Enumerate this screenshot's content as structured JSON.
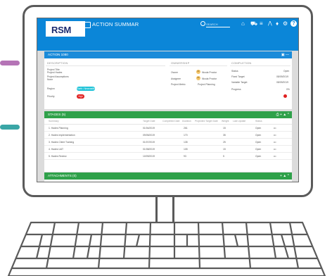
{
  "header": {
    "logo_text": "RSM",
    "app_title": "ACTION SUMMAR",
    "search_placeholder": "SEARCH",
    "icons": [
      "search-icon",
      "home-icon",
      "car-icon",
      "list-icon",
      "chart-icon",
      "bell-icon",
      "gear-icon",
      "help-icon"
    ]
  },
  "action": {
    "bar_title": "ACTION 1080",
    "description": {
      "heading": "DESCRIPTION",
      "project_title_label": "Project Title",
      "project_title_value": "Project Hades",
      "assumptions_label": "Project Assumptions",
      "assumptions_value": "None",
      "region_label": "Region",
      "region_value": "North / Newcastle",
      "priority_label": "Priority",
      "priority_value": "High"
    },
    "ownership": {
      "heading": "OWNERSHIP",
      "owner_label": "Owner",
      "owner_initials": "NP",
      "owner_value": "Nicola Proctor",
      "assignee_label": "Assignee",
      "assignee_initials": "NP",
      "assignee_value": "Nicola Proctor",
      "project_metric_label": "Project Metric",
      "project_metric_value": "Project Planning"
    },
    "completion": {
      "heading": "COMPLETION",
      "status_label": "Status",
      "status_value": "Open",
      "fixed_target_label": "Fixed Target",
      "fixed_target_value": "08/09/2019",
      "variable_target_label": "Variable Target",
      "variable_target_value": "08/09/2019",
      "progress_label": "Progress",
      "progress_value": "0%",
      "progress_fraction": 0.0,
      "status_dot_color": "#e02020"
    }
  },
  "stages": {
    "bar_title": "STAGES (5)",
    "columns": [
      "Summary",
      "Target Date",
      "Completed Date",
      "Duration",
      "Projected Target Date",
      "Weight",
      "Last Update",
      "Status"
    ],
    "rows": [
      {
        "summary": "1. Hades Planning",
        "target": "01/04/2019",
        "completed": "",
        "duration": "261",
        "projected": "",
        "weight": "15",
        "last_update": "",
        "status": "Open"
      },
      {
        "summary": "2. Hades Implementation",
        "target": "09/05/2019",
        "completed": "",
        "duration": "170",
        "projected": "",
        "weight": "35",
        "last_update": "",
        "status": "Open"
      },
      {
        "summary": "3. Hades Client Training",
        "target": "01/07/2019",
        "completed": "",
        "duration": "135",
        "projected": "",
        "weight": "25",
        "last_update": "",
        "status": "Open"
      },
      {
        "summary": "4. Hades UAT",
        "target": "01/08/2019",
        "completed": "",
        "duration": "105",
        "projected": "",
        "weight": "15",
        "last_update": "",
        "status": "Open"
      },
      {
        "summary": "5. Hades Review",
        "target": "10/09/2019",
        "completed": "",
        "duration": "93",
        "projected": "",
        "weight": "5",
        "last_update": "",
        "status": "Open"
      }
    ],
    "row_menu": "•••"
  },
  "attachments": {
    "bar_title": "ATTACHMENTS (0)"
  },
  "colors": {
    "header_blue": "#0b86d8",
    "bar_blue": "#1a8bd9",
    "bar_green": "#2fa14a",
    "region_pill": "#1fc3d8",
    "priority_pill": "#e02020",
    "accent_purple": "#b574b6",
    "accent_teal": "#3aa6a6"
  }
}
